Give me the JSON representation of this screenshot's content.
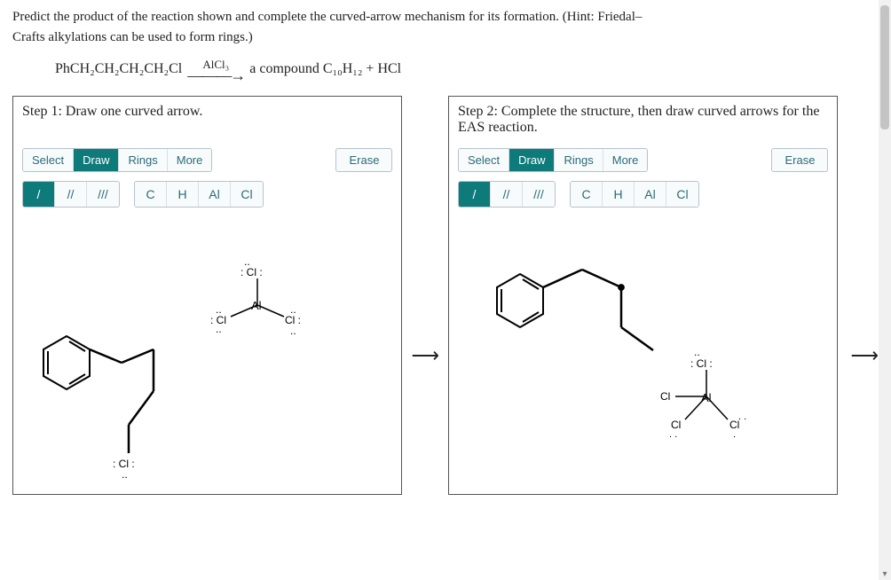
{
  "question_line1": "Predict the product of the reaction shown and complete the curved-arrow mechanism for its formation. (Hint: Friedal–",
  "question_line2": "Crafts alkylations can be used to form rings.)",
  "equation": {
    "left": "PhCH₂CH₂CH₂CH₂Cl",
    "reagent": "AlCl₃",
    "right": "a compound C₁₀H₁₂ + HCl"
  },
  "step1": {
    "title": "Step 1: Draw one curved arrow.",
    "modes": [
      "Select",
      "Draw",
      "Rings",
      "More"
    ],
    "active_mode": "Draw",
    "erase": "Erase",
    "bond_tools": [
      "/",
      "//",
      "///"
    ],
    "active_bond": "/",
    "elements": [
      "C",
      "H",
      "Al",
      "Cl"
    ]
  },
  "step2": {
    "title": "Step 2: Complete the structure, then draw curved arrows for the EAS reaction.",
    "modes": [
      "Select",
      "Draw",
      "Rings",
      "More"
    ],
    "active_mode": "Draw",
    "erase": "Erase",
    "bond_tools": [
      "/",
      "//",
      "///"
    ],
    "active_bond": "/",
    "elements": [
      "C",
      "H",
      "Al",
      "Cl"
    ]
  },
  "structure1": {
    "al_label": "Al",
    "cl_top": ": Cl :",
    "cl_left": ": Cl",
    "cl_right": "Cl :",
    "cl_bottom": ": Cl :"
  },
  "structure2": {
    "al_label": "Al",
    "cl_top": ": Cl :",
    "cl_left": "Cl",
    "cl_bl": "Cl",
    "cl_br": "Cl"
  }
}
